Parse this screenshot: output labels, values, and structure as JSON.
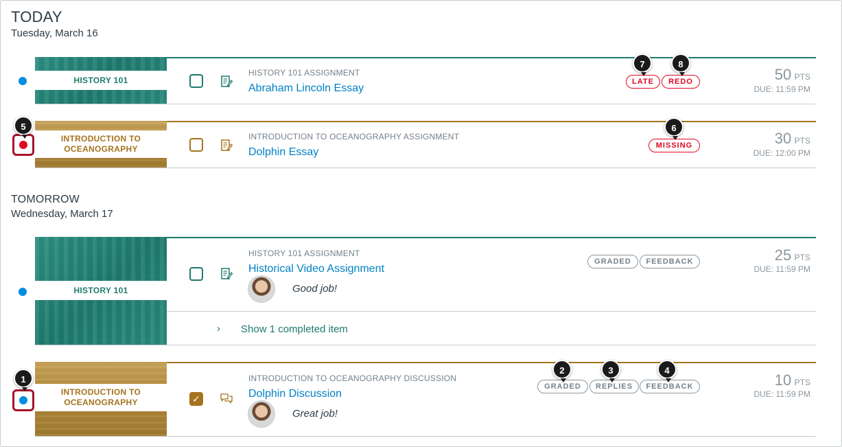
{
  "today": {
    "heading": "TODAY",
    "date": "Tuesday, March 16",
    "items": [
      {
        "course": "HISTORY 101",
        "context": "HISTORY 101 ASSIGNMENT",
        "title": "Abraham Lincoln Essay",
        "badges": [
          "LATE",
          "REDO"
        ],
        "points": "50",
        "points_unit": "PTS",
        "due": "DUE: 11:59 PM"
      },
      {
        "course": "INTRODUCTION TO OCEANOGRAPHY",
        "context": "INTRODUCTION TO OCEANOGRAPHY ASSIGNMENT",
        "title": "Dolphin Essay",
        "badges": [
          "MISSING"
        ],
        "points": "30",
        "points_unit": "PTS",
        "due": "DUE: 12:00 PM"
      }
    ]
  },
  "tomorrow": {
    "heading": "TOMORROW",
    "date": "Wednesday, March 17",
    "items": [
      {
        "course": "HISTORY 101",
        "context": "HISTORY 101 ASSIGNMENT",
        "title": "Historical Video Assignment",
        "badges": [
          "GRADED",
          "FEEDBACK"
        ],
        "comment": "Good job!",
        "points": "25",
        "points_unit": "PTS",
        "due": "DUE: 11:59 PM",
        "show_completed": "Show 1 completed item"
      },
      {
        "course": "INTRODUCTION TO OCEANOGRAPHY",
        "context": "INTRODUCTION TO OCEANOGRAPHY DISCUSSION",
        "title": "Dolphin Discussion",
        "badges": [
          "GRADED",
          "REPLIES",
          "FEEDBACK"
        ],
        "comment": "Great job!",
        "points": "10",
        "points_unit": "PTS",
        "due": "DUE: 11:59 PM"
      }
    ]
  },
  "callouts": [
    "1",
    "2",
    "3",
    "4",
    "5",
    "6",
    "7",
    "8"
  ],
  "icons": {
    "assignment": "assignment-icon",
    "discussion": "discussion-icon",
    "chevron": "chevron-right-icon"
  },
  "colors": {
    "history": "#1f7a6e",
    "ocean": "#a5731e",
    "link": "#0081c4",
    "alert": "#e0061f",
    "new_dot": "#008ee2"
  }
}
